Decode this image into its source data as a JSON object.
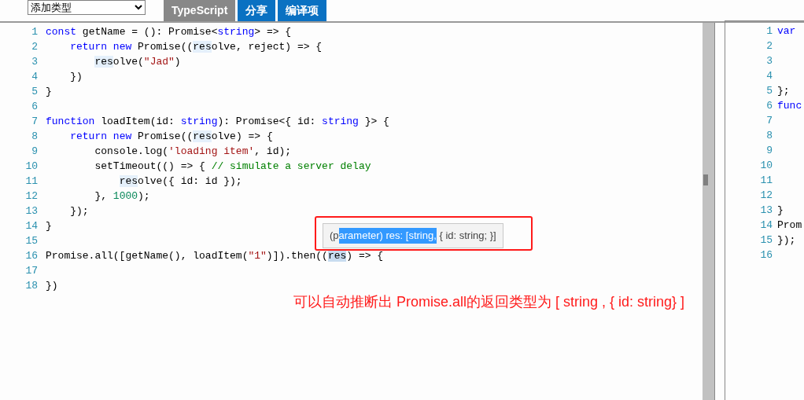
{
  "toolbar": {
    "type_select": {
      "value": "添加类型"
    },
    "tabs": [
      {
        "label": "TypeScript",
        "selected": true
      },
      {
        "label": "分享",
        "selected": false
      },
      {
        "label": "编译项",
        "selected": false
      }
    ]
  },
  "editor": {
    "lines": [
      {
        "number": "1",
        "tokens": [
          {
            "t": "const",
            "kind": "kw"
          },
          {
            "t": " getName = (): Promise<",
            "kind": "p"
          },
          {
            "t": "string",
            "kind": "kw"
          },
          {
            "t": "> => {",
            "kind": "p"
          }
        ]
      },
      {
        "number": "2",
        "tokens": [
          {
            "t": "    return",
            "kind": "kw"
          },
          {
            "t": " new",
            "kind": "kw"
          },
          {
            "t": " Promise((",
            "kind": "p"
          },
          {
            "t": "res",
            "kind": "match"
          },
          {
            "t": "olve, reject) => {",
            "kind": "p"
          }
        ]
      },
      {
        "number": "3",
        "tokens": [
          {
            "t": "        res",
            "kind": "match"
          },
          {
            "t": "olve(",
            "kind": "p"
          },
          {
            "t": "\"Jad\"",
            "kind": "str"
          },
          {
            "t": ")",
            "kind": "p"
          }
        ]
      },
      {
        "number": "4",
        "tokens": [
          {
            "t": "    })",
            "kind": "p"
          }
        ]
      },
      {
        "number": "5",
        "tokens": [
          {
            "t": "}",
            "kind": "p"
          }
        ]
      },
      {
        "number": "6"
      },
      {
        "number": "7",
        "tokens": [
          {
            "t": "function",
            "kind": "kw"
          },
          {
            "t": " loadItem(id: ",
            "kind": "p"
          },
          {
            "t": "string",
            "kind": "kw"
          },
          {
            "t": "): Promise<{ id: ",
            "kind": "p"
          },
          {
            "t": "string",
            "kind": "kw"
          },
          {
            "t": " }> {",
            "kind": "p"
          }
        ]
      },
      {
        "number": "8",
        "tokens": [
          {
            "t": "    return",
            "kind": "kw"
          },
          {
            "t": " new",
            "kind": "kw"
          },
          {
            "t": " Promise((",
            "kind": "p"
          },
          {
            "t": "res",
            "kind": "match"
          },
          {
            "t": "olve) => {",
            "kind": "p"
          }
        ]
      },
      {
        "number": "9",
        "tokens": [
          {
            "t": "        console.log(",
            "kind": "p"
          },
          {
            "t": "'loading item'",
            "kind": "str"
          },
          {
            "t": ", id);",
            "kind": "p"
          }
        ]
      },
      {
        "number": "10",
        "tokens": [
          {
            "t": "        setTimeout(() => { ",
            "kind": "p"
          },
          {
            "t": "// simulate a server delay",
            "kind": "com"
          }
        ]
      },
      {
        "number": "11",
        "tokens": [
          {
            "t": "            res",
            "kind": "match"
          },
          {
            "t": "olve({ id: id });",
            "kind": "p"
          }
        ]
      },
      {
        "number": "12",
        "tokens": [
          {
            "t": "        }, ",
            "kind": "p"
          },
          {
            "t": "1000",
            "kind": "num"
          },
          {
            "t": ");",
            "kind": "p"
          }
        ]
      },
      {
        "number": "13",
        "tokens": [
          {
            "t": "    });",
            "kind": "p"
          }
        ]
      },
      {
        "number": "14",
        "tokens": [
          {
            "t": "}",
            "kind": "p"
          }
        ]
      },
      {
        "number": "15"
      },
      {
        "number": "16",
        "tokens": [
          {
            "t": "Promise.all([getName(), loadItem(",
            "kind": "p"
          },
          {
            "t": "\"1\"",
            "kind": "str"
          },
          {
            "t": ")]).then((",
            "kind": "p"
          },
          {
            "t": "res",
            "kind": "selection"
          },
          {
            "t": ") => {",
            "kind": "p"
          }
        ]
      },
      {
        "number": "17"
      },
      {
        "number": "18",
        "tokens": [
          {
            "t": "})",
            "kind": "p"
          }
        ]
      }
    ],
    "tooltip": [
      {
        "text": "(p",
        "selected": false
      },
      {
        "text": "arameter) res: [string,",
        "selected": true
      },
      {
        "text": " { id: string; }]",
        "selected": false
      }
    ],
    "annotation": "可以自动推断出 Promise.all的返回类型为 [ string , { id: string} ]"
  },
  "output": {
    "lines": [
      {
        "number": "1",
        "tokens": [
          {
            "t": "var",
            "kind": "kw"
          }
        ]
      },
      {
        "number": "2"
      },
      {
        "number": "3"
      },
      {
        "number": "4"
      },
      {
        "number": "5",
        "tokens": [
          {
            "t": "};",
            "kind": "p"
          }
        ]
      },
      {
        "number": "6",
        "tokens": [
          {
            "t": "func",
            "kind": "kw"
          }
        ]
      },
      {
        "number": "7"
      },
      {
        "number": "8"
      },
      {
        "number": "9"
      },
      {
        "number": "10"
      },
      {
        "number": "11"
      },
      {
        "number": "12"
      },
      {
        "number": "13",
        "tokens": [
          {
            "t": "}",
            "kind": "p"
          }
        ]
      },
      {
        "number": "14",
        "tokens": [
          {
            "t": "Prom",
            "kind": "p"
          }
        ]
      },
      {
        "number": "15",
        "tokens": [
          {
            "t": "});",
            "kind": "p"
          }
        ]
      },
      {
        "number": "16"
      }
    ]
  }
}
